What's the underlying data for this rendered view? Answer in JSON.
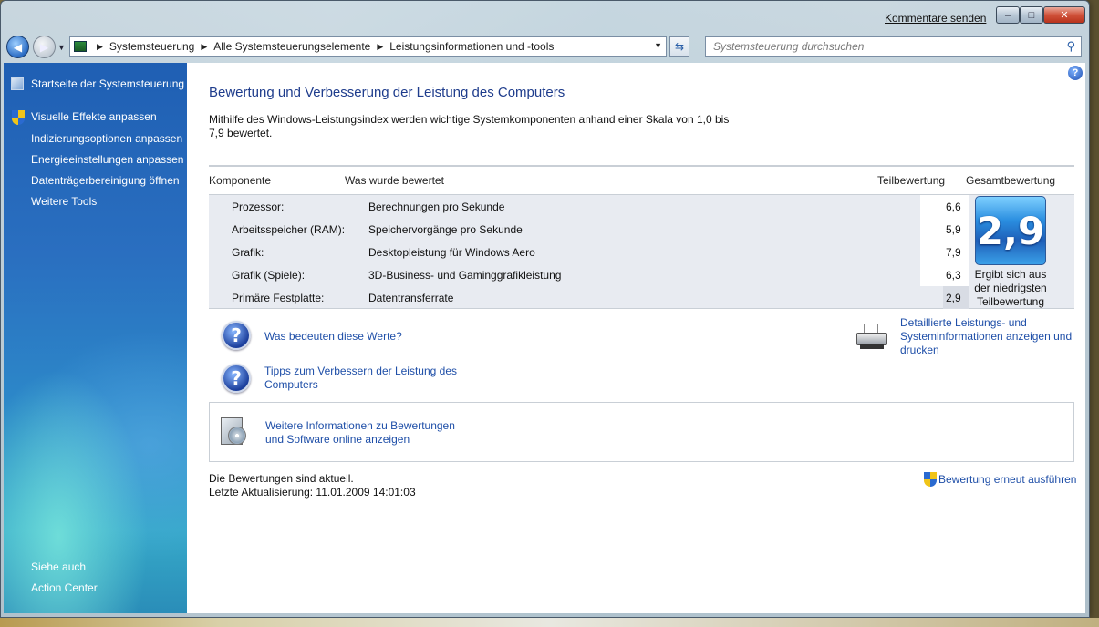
{
  "window": {
    "feedback_link": "Kommentare senden",
    "minimize_glyph": "‒",
    "maximize_glyph": "□",
    "close_glyph": "✕"
  },
  "navigation": {
    "back_icon": "arrow-left-icon",
    "forward_icon": "arrow-right-icon",
    "breadcrumbs": [
      "Systemsteuerung",
      "Alle Systemsteuerungselemente",
      "Leistungsinformationen und -tools"
    ],
    "search_placeholder": "Systemsteuerung durchsuchen"
  },
  "sidebar": {
    "home": "Startseite der Systemsteuerung",
    "tasks": [
      "Visuelle Effekte anpassen",
      "Indizierungsoptionen anpassen",
      "Energieeinstellungen anpassen",
      "Datenträgerbereinigung öffnen",
      "Weitere Tools"
    ],
    "see_also_heading": "Siehe auch",
    "see_also": [
      "Action Center"
    ]
  },
  "main": {
    "title": "Bewertung und Verbesserung der Leistung des Computers",
    "intro_line1": "Mithilfe des Windows-Leistungsindex werden wichtige Systemkomponenten anhand einer Skala von 1,0 bis",
    "intro_line2": "7,9 bewertet.",
    "table": {
      "headers": {
        "component": "Komponente",
        "rated": "Was wurde bewertet",
        "subscore": "Teilbewertung",
        "basescore": "Gesamtbewertung"
      },
      "rows": [
        {
          "component": "Prozessor:",
          "rated": "Berechnungen pro Sekunde",
          "score": "6,6"
        },
        {
          "component": "Arbeitsspeicher (RAM):",
          "rated": "Speichervorgänge pro Sekunde",
          "score": "5,9"
        },
        {
          "component": "Grafik:",
          "rated": "Desktopleistung für Windows Aero",
          "score": "7,9"
        },
        {
          "component": "Grafik (Spiele):",
          "rated": "3D-Business- und Gaminggrafikleistung",
          "score": "6,3"
        },
        {
          "component": "Primäre Festplatte:",
          "rated": "Datentransferrate",
          "score": "2,9"
        }
      ],
      "base_score": "2,9",
      "base_caption_line1": "Ergibt sich aus",
      "base_caption_line2": "der niedrigsten",
      "base_caption_line3": "Teilbewertung"
    },
    "links": {
      "what_do_scores_mean": "Was bedeuten diese Werte?",
      "tips_line1": "Tipps zum Verbessern der Leistung des",
      "tips_line2": "Computers",
      "details_line1": "Detaillierte Leistungs- und",
      "details_line2": "Systeminformationen anzeigen und",
      "details_line3": "drucken",
      "online_line1": "Weitere Informationen zu Bewertungen",
      "online_line2": "und Software online anzeigen"
    },
    "status_line1": "Die Bewertungen sind aktuell.",
    "status_line2": "Letzte Aktualisierung: 11.01.2009 14:01:03",
    "rerun_link": "Bewertung erneut ausführen",
    "help_glyph": "?"
  }
}
